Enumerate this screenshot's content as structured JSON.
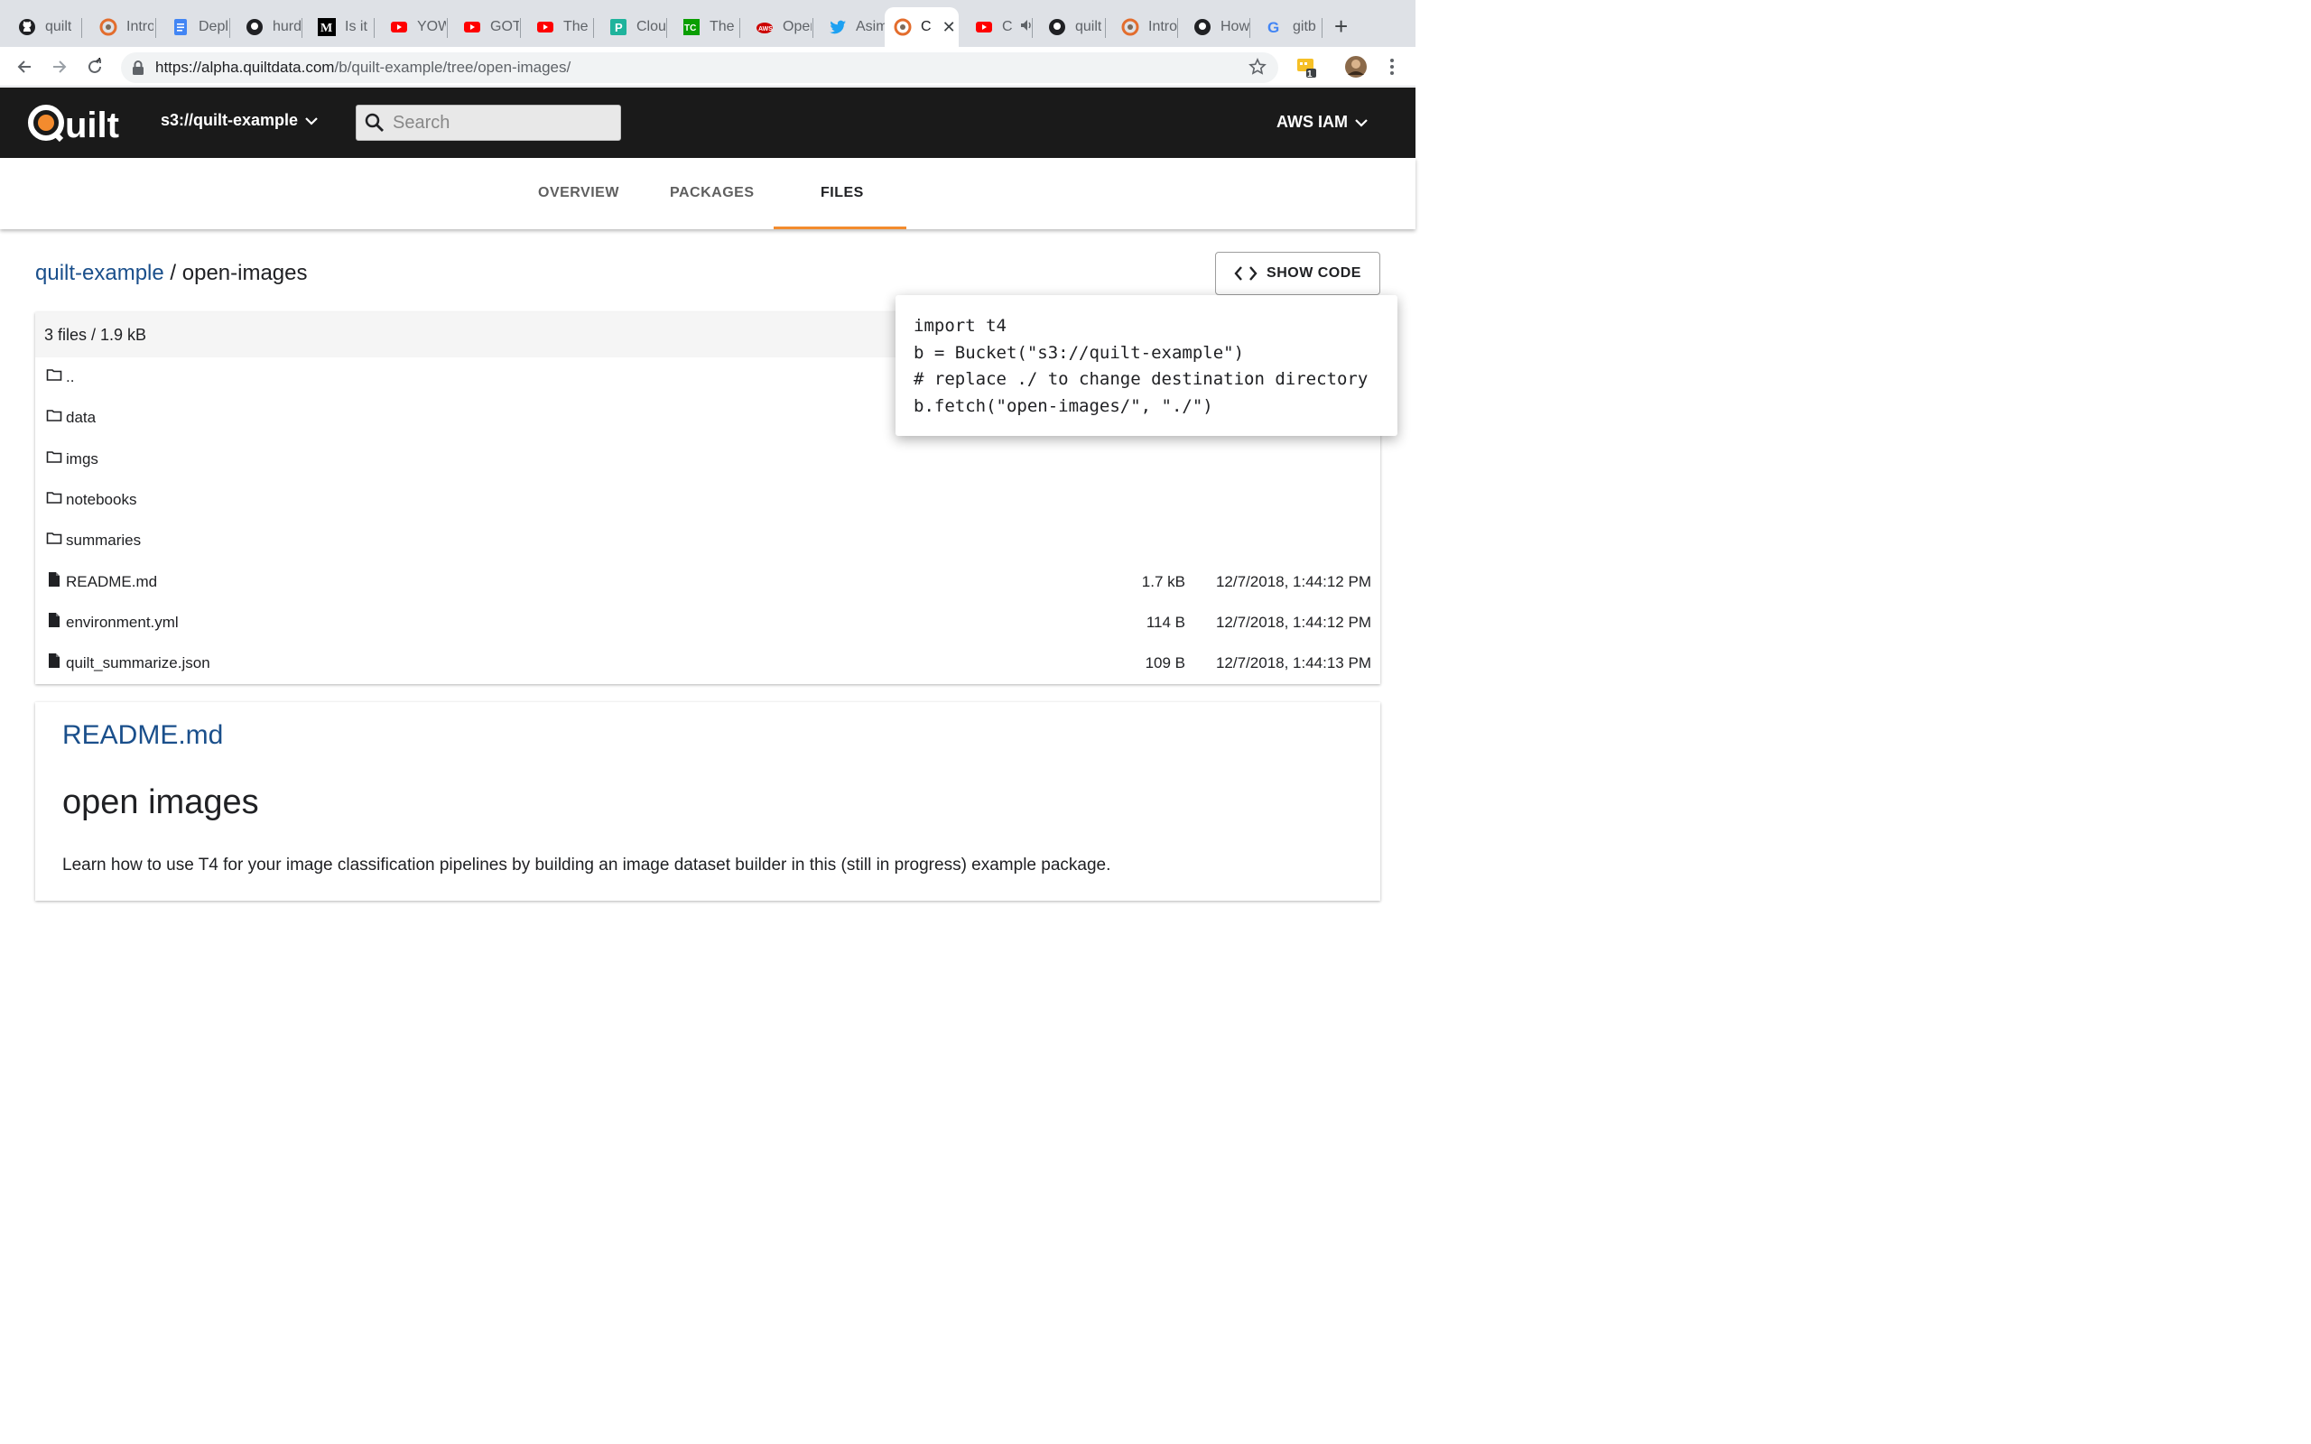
{
  "browser": {
    "tabs": [
      {
        "title": "quilt",
        "icon": "github-icon"
      },
      {
        "title": "Intro",
        "icon": "quilt-icon"
      },
      {
        "title": "Depl",
        "icon": "docs-icon"
      },
      {
        "title": "hurd",
        "icon": "github-icon"
      },
      {
        "title": "Is it",
        "icon": "medium-icon"
      },
      {
        "title": "YOW",
        "icon": "youtube-icon"
      },
      {
        "title": "GOT",
        "icon": "youtube-icon"
      },
      {
        "title": "The",
        "icon": "youtube-icon"
      },
      {
        "title": "Clou",
        "icon": "p-icon"
      },
      {
        "title": "The",
        "icon": "techcrunch-icon"
      },
      {
        "title": "Oper",
        "icon": "aws-icon"
      },
      {
        "title": "Asim",
        "icon": "twitter-icon"
      },
      {
        "title": "C",
        "icon": "quilt-icon",
        "active": true
      },
      {
        "title": "C",
        "icon": "youtube-icon"
      },
      {
        "title": "quilt",
        "icon": "github-icon"
      },
      {
        "title": "Intro",
        "icon": "quilt-icon"
      },
      {
        "title": "How",
        "icon": "github-icon"
      },
      {
        "title": "gitb",
        "icon": "google-icon"
      }
    ],
    "url_host": "https://alpha.quiltdata.com",
    "url_path": "/b/quilt-example/tree/open-images/",
    "extension_badge": "1"
  },
  "header": {
    "logo_text": "Quilt",
    "bucket": "s3://quilt-example",
    "search_placeholder": "Search",
    "auth_label": "AWS IAM"
  },
  "nav": {
    "tabs": [
      "OVERVIEW",
      "PACKAGES",
      "FILES"
    ],
    "active": "FILES"
  },
  "breadcrumb": {
    "root": "quilt-example",
    "separator": "/",
    "current": "open-images"
  },
  "show_code_label": "SHOW CODE",
  "code_snippet": "import t4\nb = Bucket(\"s3://quilt-example\")\n# replace ./ to change destination directory\nb.fetch(\"open-images/\", \"./\")",
  "listing": {
    "summary": "3 files / 1.9 kB",
    "entries": [
      {
        "name": "..",
        "type": "folder",
        "size": "",
        "modified": ""
      },
      {
        "name": "data",
        "type": "folder",
        "size": "",
        "modified": ""
      },
      {
        "name": "imgs",
        "type": "folder",
        "size": "",
        "modified": ""
      },
      {
        "name": "notebooks",
        "type": "folder",
        "size": "",
        "modified": ""
      },
      {
        "name": "summaries",
        "type": "folder",
        "size": "",
        "modified": ""
      },
      {
        "name": "README.md",
        "type": "file",
        "size": "1.7 kB",
        "modified": "12/7/2018, 1:44:12 PM"
      },
      {
        "name": "environment.yml",
        "type": "file",
        "size": "114 B",
        "modified": "12/7/2018, 1:44:12 PM"
      },
      {
        "name": "quilt_summarize.json",
        "type": "file",
        "size": "109 B",
        "modified": "12/7/2018, 1:44:13 PM"
      }
    ]
  },
  "readme": {
    "title": "README.md",
    "heading": "open images",
    "paragraph": "Learn how to use T4 for your image classification pipelines by building an image dataset builder in this (still in progress) example package."
  },
  "colors": {
    "accent": "#f38b2e",
    "link": "#1a4f8b",
    "header_bg": "#1a1a1a"
  }
}
